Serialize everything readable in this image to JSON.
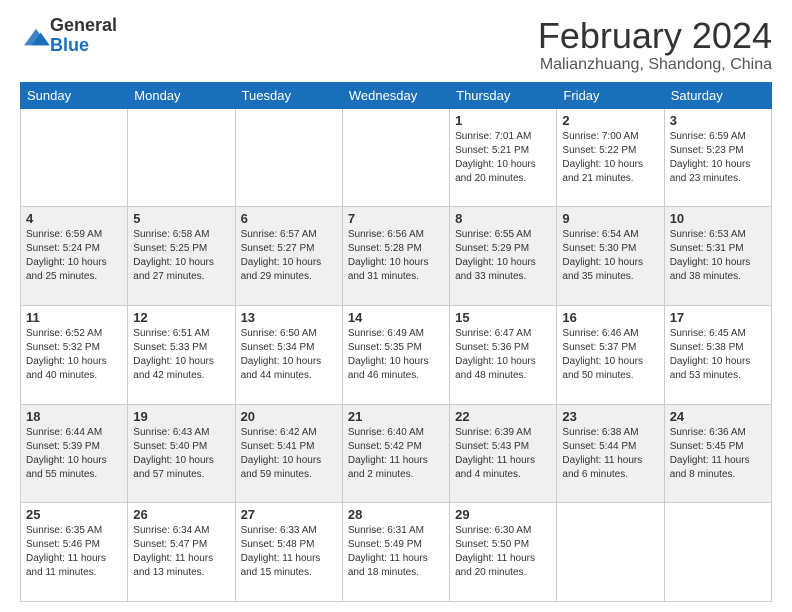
{
  "logo": {
    "text_general": "General",
    "text_blue": "Blue"
  },
  "header": {
    "month": "February 2024",
    "location": "Malianzhuang, Shandong, China"
  },
  "weekdays": [
    "Sunday",
    "Monday",
    "Tuesday",
    "Wednesday",
    "Thursday",
    "Friday",
    "Saturday"
  ],
  "weeks": [
    [
      {
        "day": "",
        "info": ""
      },
      {
        "day": "",
        "info": ""
      },
      {
        "day": "",
        "info": ""
      },
      {
        "day": "",
        "info": ""
      },
      {
        "day": "1",
        "info": "Sunrise: 7:01 AM\nSunset: 5:21 PM\nDaylight: 10 hours\nand 20 minutes."
      },
      {
        "day": "2",
        "info": "Sunrise: 7:00 AM\nSunset: 5:22 PM\nDaylight: 10 hours\nand 21 minutes."
      },
      {
        "day": "3",
        "info": "Sunrise: 6:59 AM\nSunset: 5:23 PM\nDaylight: 10 hours\nand 23 minutes."
      }
    ],
    [
      {
        "day": "4",
        "info": "Sunrise: 6:59 AM\nSunset: 5:24 PM\nDaylight: 10 hours\nand 25 minutes."
      },
      {
        "day": "5",
        "info": "Sunrise: 6:58 AM\nSunset: 5:25 PM\nDaylight: 10 hours\nand 27 minutes."
      },
      {
        "day": "6",
        "info": "Sunrise: 6:57 AM\nSunset: 5:27 PM\nDaylight: 10 hours\nand 29 minutes."
      },
      {
        "day": "7",
        "info": "Sunrise: 6:56 AM\nSunset: 5:28 PM\nDaylight: 10 hours\nand 31 minutes."
      },
      {
        "day": "8",
        "info": "Sunrise: 6:55 AM\nSunset: 5:29 PM\nDaylight: 10 hours\nand 33 minutes."
      },
      {
        "day": "9",
        "info": "Sunrise: 6:54 AM\nSunset: 5:30 PM\nDaylight: 10 hours\nand 35 minutes."
      },
      {
        "day": "10",
        "info": "Sunrise: 6:53 AM\nSunset: 5:31 PM\nDaylight: 10 hours\nand 38 minutes."
      }
    ],
    [
      {
        "day": "11",
        "info": "Sunrise: 6:52 AM\nSunset: 5:32 PM\nDaylight: 10 hours\nand 40 minutes."
      },
      {
        "day": "12",
        "info": "Sunrise: 6:51 AM\nSunset: 5:33 PM\nDaylight: 10 hours\nand 42 minutes."
      },
      {
        "day": "13",
        "info": "Sunrise: 6:50 AM\nSunset: 5:34 PM\nDaylight: 10 hours\nand 44 minutes."
      },
      {
        "day": "14",
        "info": "Sunrise: 6:49 AM\nSunset: 5:35 PM\nDaylight: 10 hours\nand 46 minutes."
      },
      {
        "day": "15",
        "info": "Sunrise: 6:47 AM\nSunset: 5:36 PM\nDaylight: 10 hours\nand 48 minutes."
      },
      {
        "day": "16",
        "info": "Sunrise: 6:46 AM\nSunset: 5:37 PM\nDaylight: 10 hours\nand 50 minutes."
      },
      {
        "day": "17",
        "info": "Sunrise: 6:45 AM\nSunset: 5:38 PM\nDaylight: 10 hours\nand 53 minutes."
      }
    ],
    [
      {
        "day": "18",
        "info": "Sunrise: 6:44 AM\nSunset: 5:39 PM\nDaylight: 10 hours\nand 55 minutes."
      },
      {
        "day": "19",
        "info": "Sunrise: 6:43 AM\nSunset: 5:40 PM\nDaylight: 10 hours\nand 57 minutes."
      },
      {
        "day": "20",
        "info": "Sunrise: 6:42 AM\nSunset: 5:41 PM\nDaylight: 10 hours\nand 59 minutes."
      },
      {
        "day": "21",
        "info": "Sunrise: 6:40 AM\nSunset: 5:42 PM\nDaylight: 11 hours\nand 2 minutes."
      },
      {
        "day": "22",
        "info": "Sunrise: 6:39 AM\nSunset: 5:43 PM\nDaylight: 11 hours\nand 4 minutes."
      },
      {
        "day": "23",
        "info": "Sunrise: 6:38 AM\nSunset: 5:44 PM\nDaylight: 11 hours\nand 6 minutes."
      },
      {
        "day": "24",
        "info": "Sunrise: 6:36 AM\nSunset: 5:45 PM\nDaylight: 11 hours\nand 8 minutes."
      }
    ],
    [
      {
        "day": "25",
        "info": "Sunrise: 6:35 AM\nSunset: 5:46 PM\nDaylight: 11 hours\nand 11 minutes."
      },
      {
        "day": "26",
        "info": "Sunrise: 6:34 AM\nSunset: 5:47 PM\nDaylight: 11 hours\nand 13 minutes."
      },
      {
        "day": "27",
        "info": "Sunrise: 6:33 AM\nSunset: 5:48 PM\nDaylight: 11 hours\nand 15 minutes."
      },
      {
        "day": "28",
        "info": "Sunrise: 6:31 AM\nSunset: 5:49 PM\nDaylight: 11 hours\nand 18 minutes."
      },
      {
        "day": "29",
        "info": "Sunrise: 6:30 AM\nSunset: 5:50 PM\nDaylight: 11 hours\nand 20 minutes."
      },
      {
        "day": "",
        "info": ""
      },
      {
        "day": "",
        "info": ""
      }
    ]
  ]
}
